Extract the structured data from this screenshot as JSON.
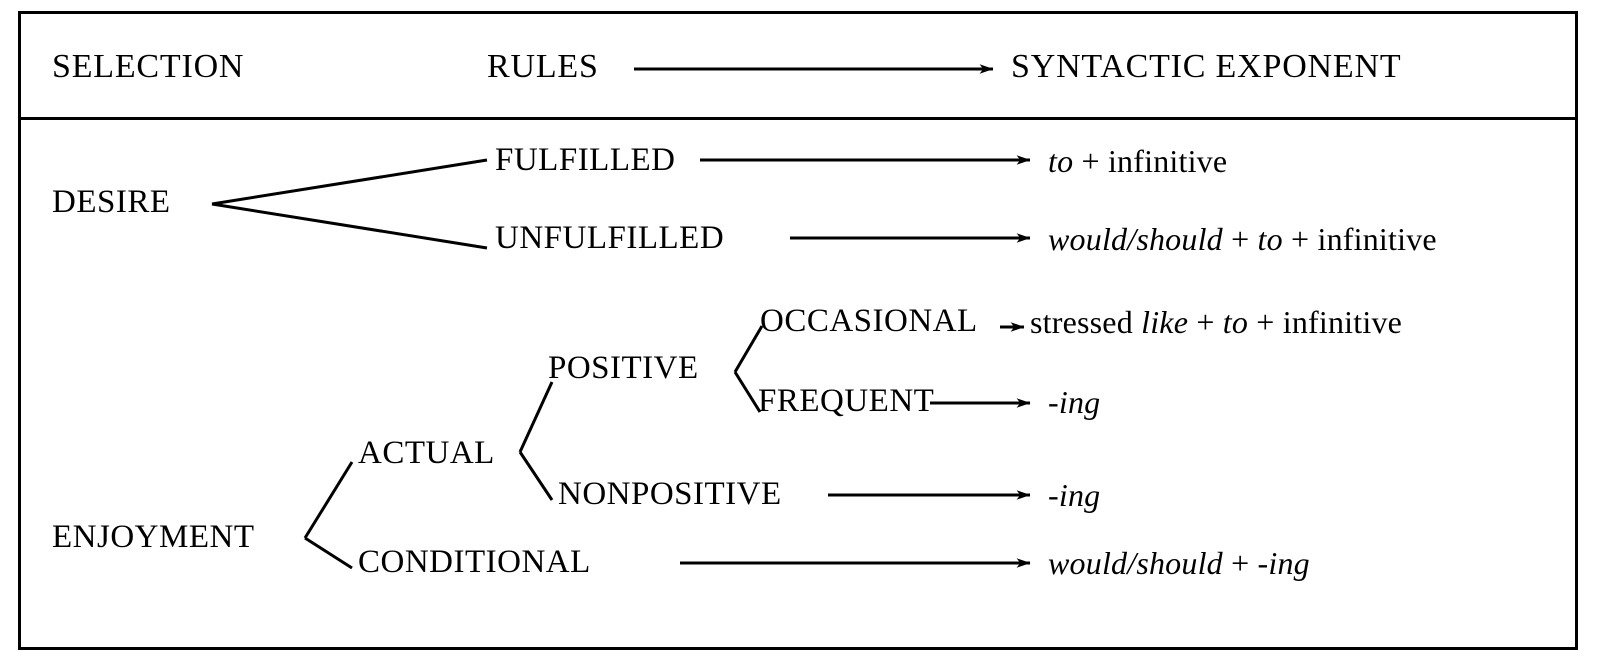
{
  "figure": {
    "kind": "linguistic-tree-table",
    "border_color": "#000000",
    "background": "#ffffff"
  },
  "header": {
    "col1": "SELECTION",
    "col2": "RULES",
    "col3": "SYNTACTIC EXPONENT",
    "arrow": "header-arrow"
  },
  "selections": [
    {
      "id": "desire",
      "label": "DESIRE"
    },
    {
      "id": "enjoyment",
      "label": "ENJOYMENT"
    }
  ],
  "rules": [
    {
      "id": "fulfilled",
      "label": "FULFILLED"
    },
    {
      "id": "unfulfilled",
      "label": "UNFULFILLED"
    },
    {
      "id": "actual",
      "label": "ACTUAL"
    },
    {
      "id": "positive",
      "label": "POSITIVE"
    },
    {
      "id": "occasional",
      "label": "OCCASIONAL"
    },
    {
      "id": "frequent",
      "label": "FREQUENT"
    },
    {
      "id": "nonpositive",
      "label": "NONPOSITIVE"
    },
    {
      "id": "conditional",
      "label": "CONDITIONAL"
    }
  ],
  "exponents": [
    {
      "id": "to-infinitive",
      "parts": [
        {
          "text": "to",
          "style": "italic"
        },
        {
          "text": " + ",
          "style": "roman"
        },
        {
          "text": "infinitive",
          "style": "roman"
        }
      ],
      "plain": "to + infinitive"
    },
    {
      "id": "would-should-to-infinitive",
      "parts": [
        {
          "text": "would/should",
          "style": "italic"
        },
        {
          "text": " + ",
          "style": "roman"
        },
        {
          "text": "to",
          "style": "italic"
        },
        {
          "text": " + ",
          "style": "roman"
        },
        {
          "text": "infinitive",
          "style": "roman"
        }
      ],
      "plain": "would/should + to + infinitive"
    },
    {
      "id": "stressed-like-to-infinitive",
      "parts": [
        {
          "text": "stressed ",
          "style": "roman"
        },
        {
          "text": "like",
          "style": "italic"
        },
        {
          "text": " + ",
          "style": "roman"
        },
        {
          "text": "to",
          "style": "italic"
        },
        {
          "text": " + ",
          "style": "roman"
        },
        {
          "text": "infinitive",
          "style": "roman"
        }
      ],
      "plain": "stressed like + to + infinitive"
    },
    {
      "id": "ing-frequent",
      "parts": [
        {
          "text": "-ing",
          "style": "italic"
        }
      ],
      "plain": "-ing"
    },
    {
      "id": "ing-nonpositive",
      "parts": [
        {
          "text": "-ing",
          "style": "italic"
        }
      ],
      "plain": "-ing"
    },
    {
      "id": "would-should-ing",
      "parts": [
        {
          "text": "would/should",
          "style": "italic"
        },
        {
          "text": " + ",
          "style": "roman"
        },
        {
          "text": "-ing",
          "style": "italic"
        }
      ],
      "plain": "would/should + -ing"
    }
  ],
  "mappings": [
    {
      "selection": "DESIRE",
      "rule": "FULFILLED",
      "exponent": "to + infinitive"
    },
    {
      "selection": "DESIRE",
      "rule": "UNFULFILLED",
      "exponent": "would/should + to + infinitive"
    },
    {
      "selection": "ENJOYMENT",
      "rule": "ACTUAL > POSITIVE > OCCASIONAL",
      "exponent": "stressed like + to + infinitive"
    },
    {
      "selection": "ENJOYMENT",
      "rule": "ACTUAL > POSITIVE > FREQUENT",
      "exponent": "-ing"
    },
    {
      "selection": "ENJOYMENT",
      "rule": "ACTUAL > NONPOSITIVE",
      "exponent": "-ing"
    },
    {
      "selection": "ENJOYMENT",
      "rule": "CONDITIONAL",
      "exponent": "would/should + -ing"
    }
  ]
}
